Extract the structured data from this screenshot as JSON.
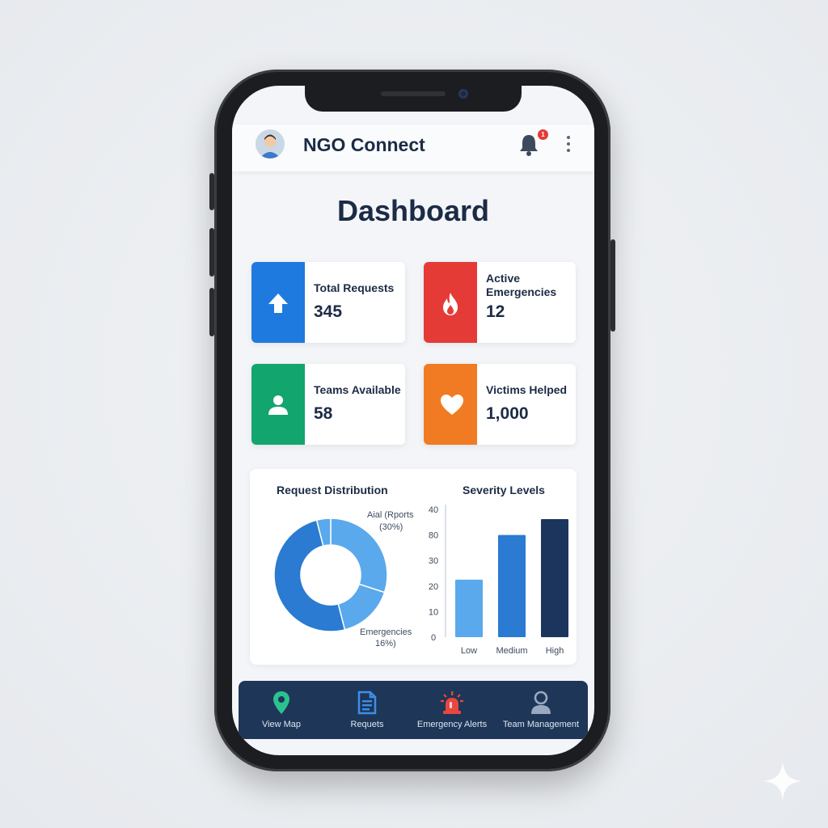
{
  "app": {
    "title": "NGO Connect",
    "notification_count": "1"
  },
  "page": {
    "title": "Dashboard"
  },
  "stats": [
    {
      "label": "Total Requests",
      "value": "345",
      "color": "#1f7ae0",
      "icon": "arrow-up-icon"
    },
    {
      "label": "Active Emergencies",
      "value": "12",
      "color": "#e53b36",
      "icon": "flame-icon"
    },
    {
      "label": "Teams Available",
      "value": "58",
      "color": "#12a56e",
      "icon": "person-icon"
    },
    {
      "label": "Victims Helped",
      "value": "1,000",
      "color": "#f07b22",
      "icon": "heart-icon"
    }
  ],
  "charts": {
    "donut_title": "Request Distribution",
    "donut_label_top": "Aial (Rports",
    "donut_label_top_pct": "(30%)",
    "donut_label_bottom": "Emergencies",
    "donut_label_bottom_pct": "16%)",
    "bar_title": "Severity Levels"
  },
  "chart_data": [
    {
      "type": "pie",
      "title": "Request Distribution",
      "slices": [
        {
          "name": "Aial (Rports",
          "value": 30,
          "color": "#5aa9ec"
        },
        {
          "name": "Emergencies",
          "value": 16,
          "color": "#5aa9ec"
        },
        {
          "name": "",
          "value": 50,
          "color": "#2a7bd1"
        },
        {
          "name": "",
          "value": 4,
          "color": "#5aa9ec"
        }
      ]
    },
    {
      "type": "bar",
      "title": "Severity Levels",
      "categories": [
        "Low",
        "Medium",
        "High"
      ],
      "values": [
        18,
        32,
        40
      ],
      "colors": [
        "#5aa9ec",
        "#2a7bd1",
        "#1c355d"
      ],
      "y_ticks": [
        "0",
        "10",
        "20",
        "30",
        "80",
        "40"
      ],
      "ylim": [
        0,
        40
      ]
    }
  ],
  "nav": [
    {
      "label": "View Map",
      "icon": "map-pin-icon",
      "color": "#2bc28e"
    },
    {
      "label": "Requets",
      "icon": "document-icon",
      "color": "#3c8fe8"
    },
    {
      "label": "Emergency Alerts",
      "icon": "siren-icon",
      "color": "#e8473f"
    },
    {
      "label": "Team Management",
      "icon": "user-icon",
      "color": "#9aa9bf"
    }
  ]
}
